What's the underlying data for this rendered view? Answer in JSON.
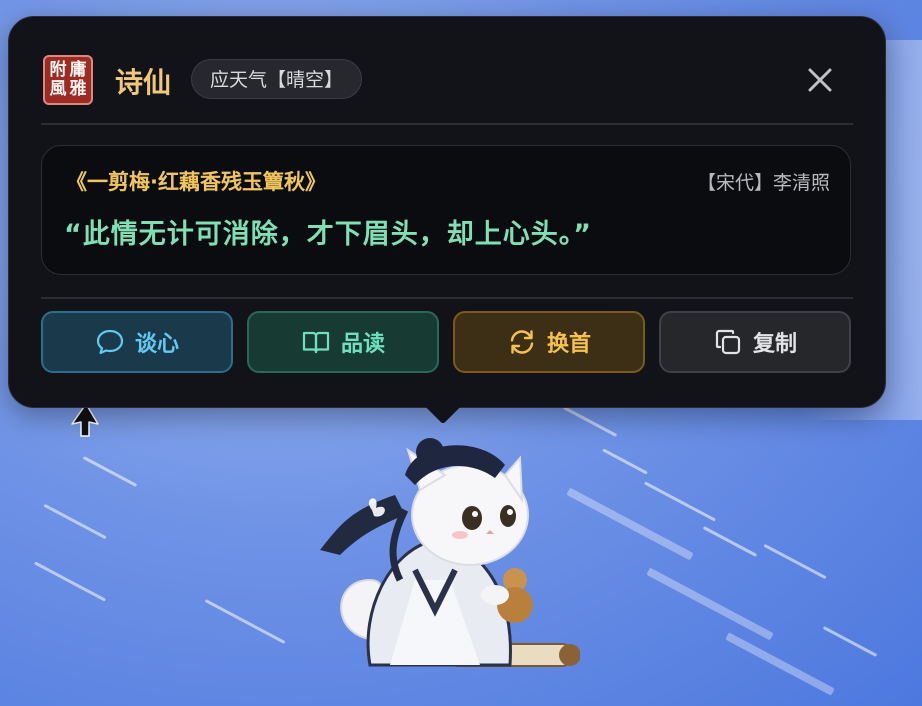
{
  "header": {
    "seal_chars": [
      "附",
      "庸",
      "風",
      "雅"
    ],
    "title": "诗仙",
    "weather_badge": "应天气【晴空】"
  },
  "poem": {
    "title": "《一剪梅·红藕香残玉簟秋》",
    "meta": "【宋代】李清照",
    "line": "“此情无计可消除，才下眉头，却上心头。”"
  },
  "actions": {
    "talk_label": "谈心",
    "read_label": "品读",
    "swap_label": "换首",
    "copy_label": "复制"
  },
  "icons": {
    "close": "close-icon",
    "talk": "chat-bubble-icon",
    "read": "open-book-icon",
    "swap": "refresh-icon",
    "copy": "copy-icon"
  },
  "colors": {
    "title_gold": "#f0c87a",
    "poem_title": "#f0c55c",
    "poem_line": "#7fe0b6",
    "talk": "#62c9ef",
    "read": "#6ee0be",
    "swap": "#f6c24e",
    "seal_red": "#9e2a24"
  }
}
